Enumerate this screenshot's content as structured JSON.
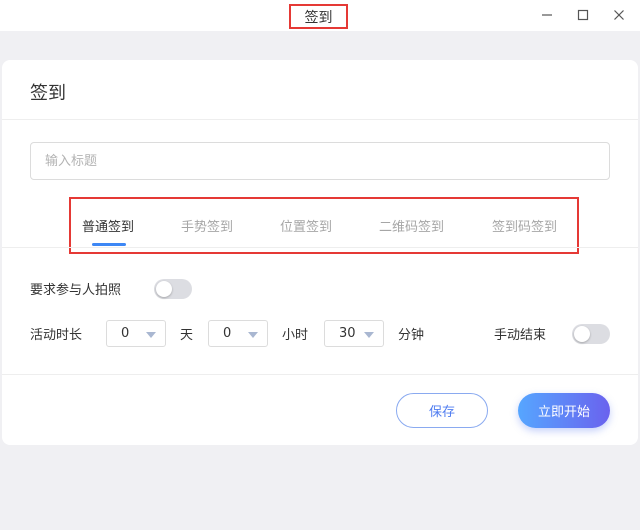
{
  "window": {
    "title": "签到"
  },
  "dialog": {
    "title": "签到",
    "title_input": {
      "placeholder": "输入标题",
      "value": ""
    },
    "tabs": [
      {
        "label": "普通签到",
        "active": true
      },
      {
        "label": "手势签到",
        "active": false
      },
      {
        "label": "位置签到",
        "active": false
      },
      {
        "label": "二维码签到",
        "active": false
      },
      {
        "label": "签到码签到",
        "active": false
      }
    ],
    "photo_requirement": {
      "label": "要求参与人拍照",
      "enabled": false
    },
    "duration": {
      "label": "活动时长",
      "days": {
        "value": "0",
        "unit": "天"
      },
      "hours": {
        "value": "0",
        "unit": "小时"
      },
      "minutes": {
        "value": "30",
        "unit": "分钟"
      }
    },
    "manual_end": {
      "label": "手动结束",
      "enabled": false
    },
    "save_label": "保存",
    "start_label": "立即开始"
  },
  "colors": {
    "accent": "#3d87f5",
    "highlight_box": "#e53935",
    "start_gradient_from": "#56a6ff",
    "start_gradient_to": "#6a62ee"
  }
}
